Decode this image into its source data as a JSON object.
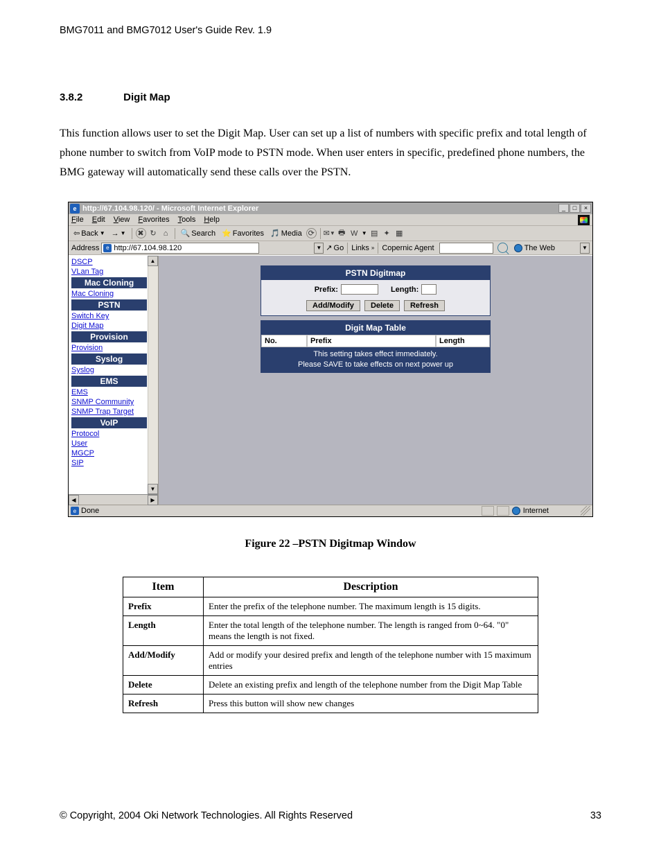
{
  "running_header": "BMG7011 and BMG7012 User's Guide Rev. 1.9",
  "section": {
    "num": "3.8.2",
    "title": "Digit Map"
  },
  "body_paragraph": "This function allows user to set the Digit Map. User can set up a list of numbers with specific prefix and total length of phone number to switch from VoIP mode to PSTN mode. When user enters in specific, predefined phone numbers, the BMG gateway will automatically send these calls over the PSTN.",
  "screenshot": {
    "window_title": "http://67.104.98.120/ - Microsoft Internet Explorer",
    "window_buttons": {
      "minimize": "_",
      "maximize": "□",
      "close": "×"
    },
    "menus": [
      "File",
      "Edit",
      "View",
      "Favorites",
      "Tools",
      "Help"
    ],
    "toolbar": {
      "back": "Back",
      "search": "Search",
      "favorites": "Favorites",
      "media": "Media"
    },
    "address_bar": {
      "label": "Address",
      "url": "http://67.104.98.120",
      "go": "Go",
      "links": "Links",
      "copernic": "Copernic Agent",
      "the_web": "The Web"
    },
    "sidebar": [
      {
        "type": "link",
        "text": "DSCP"
      },
      {
        "type": "link",
        "text": "VLan Tag"
      },
      {
        "type": "header",
        "text": "Mac Cloning"
      },
      {
        "type": "link",
        "text": "Mac Cloning"
      },
      {
        "type": "header",
        "text": "PSTN"
      },
      {
        "type": "link",
        "text": "Switch Key"
      },
      {
        "type": "link",
        "text": "Digit Map"
      },
      {
        "type": "header",
        "text": "Provision"
      },
      {
        "type": "link",
        "text": "Provision"
      },
      {
        "type": "header",
        "text": "Syslog"
      },
      {
        "type": "link",
        "text": "Syslog"
      },
      {
        "type": "header",
        "text": "EMS"
      },
      {
        "type": "link",
        "text": "EMS"
      },
      {
        "type": "link",
        "text": "SNMP Community"
      },
      {
        "type": "link",
        "text": "SNMP Trap Target"
      },
      {
        "type": "header",
        "text": "VoIP"
      },
      {
        "type": "link",
        "text": "Protocol"
      },
      {
        "type": "link",
        "text": "User"
      },
      {
        "type": "link",
        "text": "MGCP"
      },
      {
        "type": "link",
        "text": "SIP"
      }
    ],
    "pstn_panel": {
      "heading": "PSTN Digitmap",
      "prefix_label": "Prefix:",
      "length_label": "Length:",
      "add_modify": "Add/Modify",
      "delete": "Delete",
      "refresh": "Refresh"
    },
    "table_panel": {
      "heading": "Digit Map Table",
      "cols": {
        "no": "No.",
        "prefix": "Prefix",
        "length": "Length"
      },
      "note_line1": "This setting takes effect immediately.",
      "note_line2": "Please SAVE to take effects on next power up"
    },
    "status": {
      "done": "Done",
      "zone": "Internet"
    }
  },
  "figure_caption": "Figure 22 –PSTN Digitmap Window",
  "desc_table": {
    "headers": {
      "item": "Item",
      "desc": "Description"
    },
    "rows": [
      {
        "item": "Prefix",
        "desc": "Enter the prefix of the telephone number. The maximum length is 15 digits."
      },
      {
        "item": "Length",
        "desc": "Enter the total length of the telephone number. The length is ranged from 0~64. \"0\" means the length is not fixed."
      },
      {
        "item": "Add/Modify",
        "desc": "Add or modify your desired prefix and length of the telephone number with 15 maximum entries"
      },
      {
        "item": "Delete",
        "desc": "Delete an existing prefix and length of the telephone number from the Digit Map Table"
      },
      {
        "item": "Refresh",
        "desc": "Press this button will show new changes"
      }
    ]
  },
  "footer": {
    "copyright": "© Copyright, 2004 Oki Network Technologies. All Rights Reserved",
    "page": "33"
  }
}
